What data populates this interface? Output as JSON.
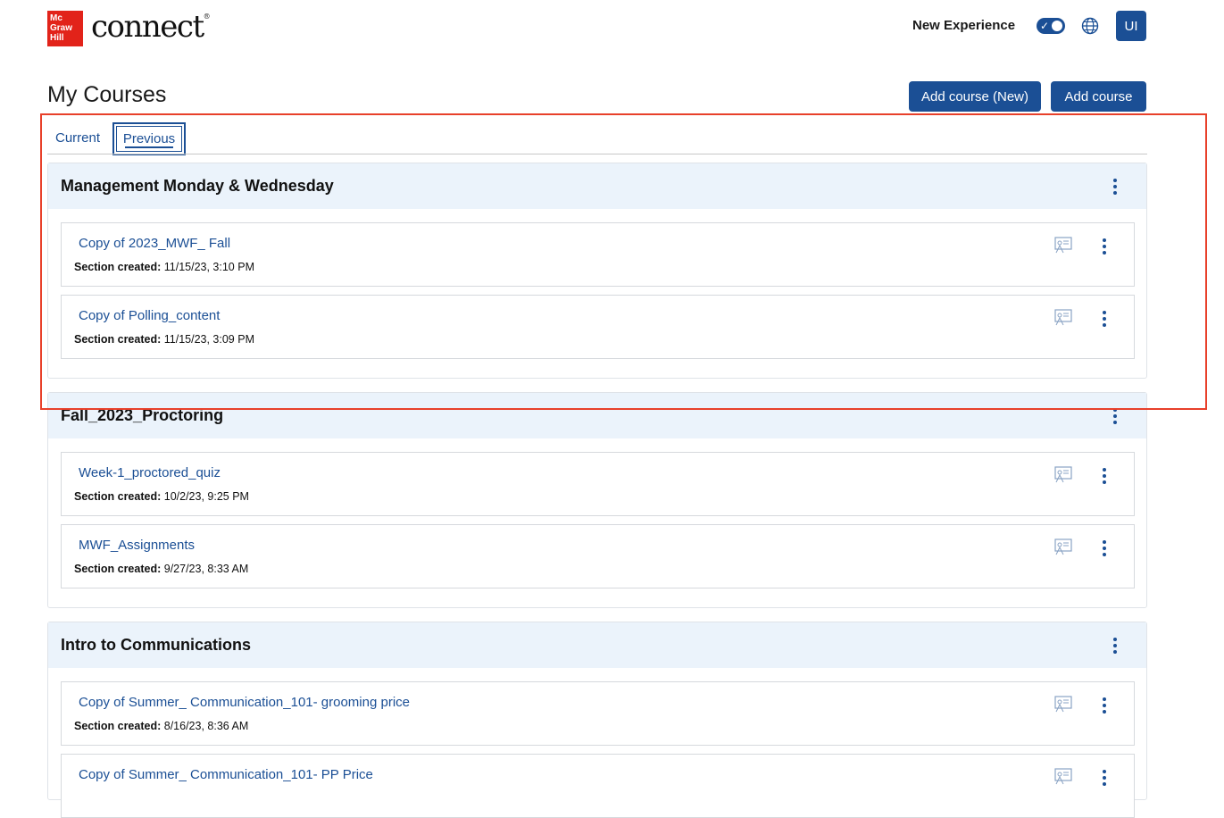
{
  "header": {
    "logo_lines": [
      "Mc",
      "Graw",
      "Hill"
    ],
    "logo_word": "connect",
    "logo_mark": "®",
    "new_experience_label": "New Experience",
    "toggle_on": true,
    "avatar_initials": "UI",
    "icons": [
      "toggle-check-icon",
      "globe-icon"
    ]
  },
  "page": {
    "title": "My Courses",
    "add_course_new_label": "Add course (New)",
    "add_course_label": "Add course"
  },
  "tabs": [
    {
      "label": "Current",
      "selected": false
    },
    {
      "label": "Previous",
      "selected": true
    }
  ],
  "section_meta_label": "Section created:",
  "groups": [
    {
      "title": "Management Monday & Wednesday",
      "sections": [
        {
          "name": "Copy of 2023_MWF_ Fall",
          "created": "11/15/23, 3:10 PM"
        },
        {
          "name": "Copy of Polling_content",
          "created": "11/15/23, 3:09 PM"
        }
      ]
    },
    {
      "title": "Fall_2023_Proctoring",
      "sections": [
        {
          "name": "Week-1_proctored_quiz",
          "created": "10/2/23, 9:25 PM"
        },
        {
          "name": "MWF_Assignments",
          "created": "9/27/23, 8:33 AM"
        }
      ]
    },
    {
      "title": "Intro to Communications",
      "sections": [
        {
          "name": "Copy of Summer_ Communication_101- grooming price",
          "created": "8/16/23, 8:36 AM"
        },
        {
          "name": "Copy of Summer_ Communication_101- PP Price",
          "created": ""
        }
      ]
    }
  ],
  "colors": {
    "brand_red": "#e2231a",
    "primary_blue": "#1b4f95",
    "group_header_bg": "#ebf3fb",
    "highlight_red": "#e8402a"
  }
}
